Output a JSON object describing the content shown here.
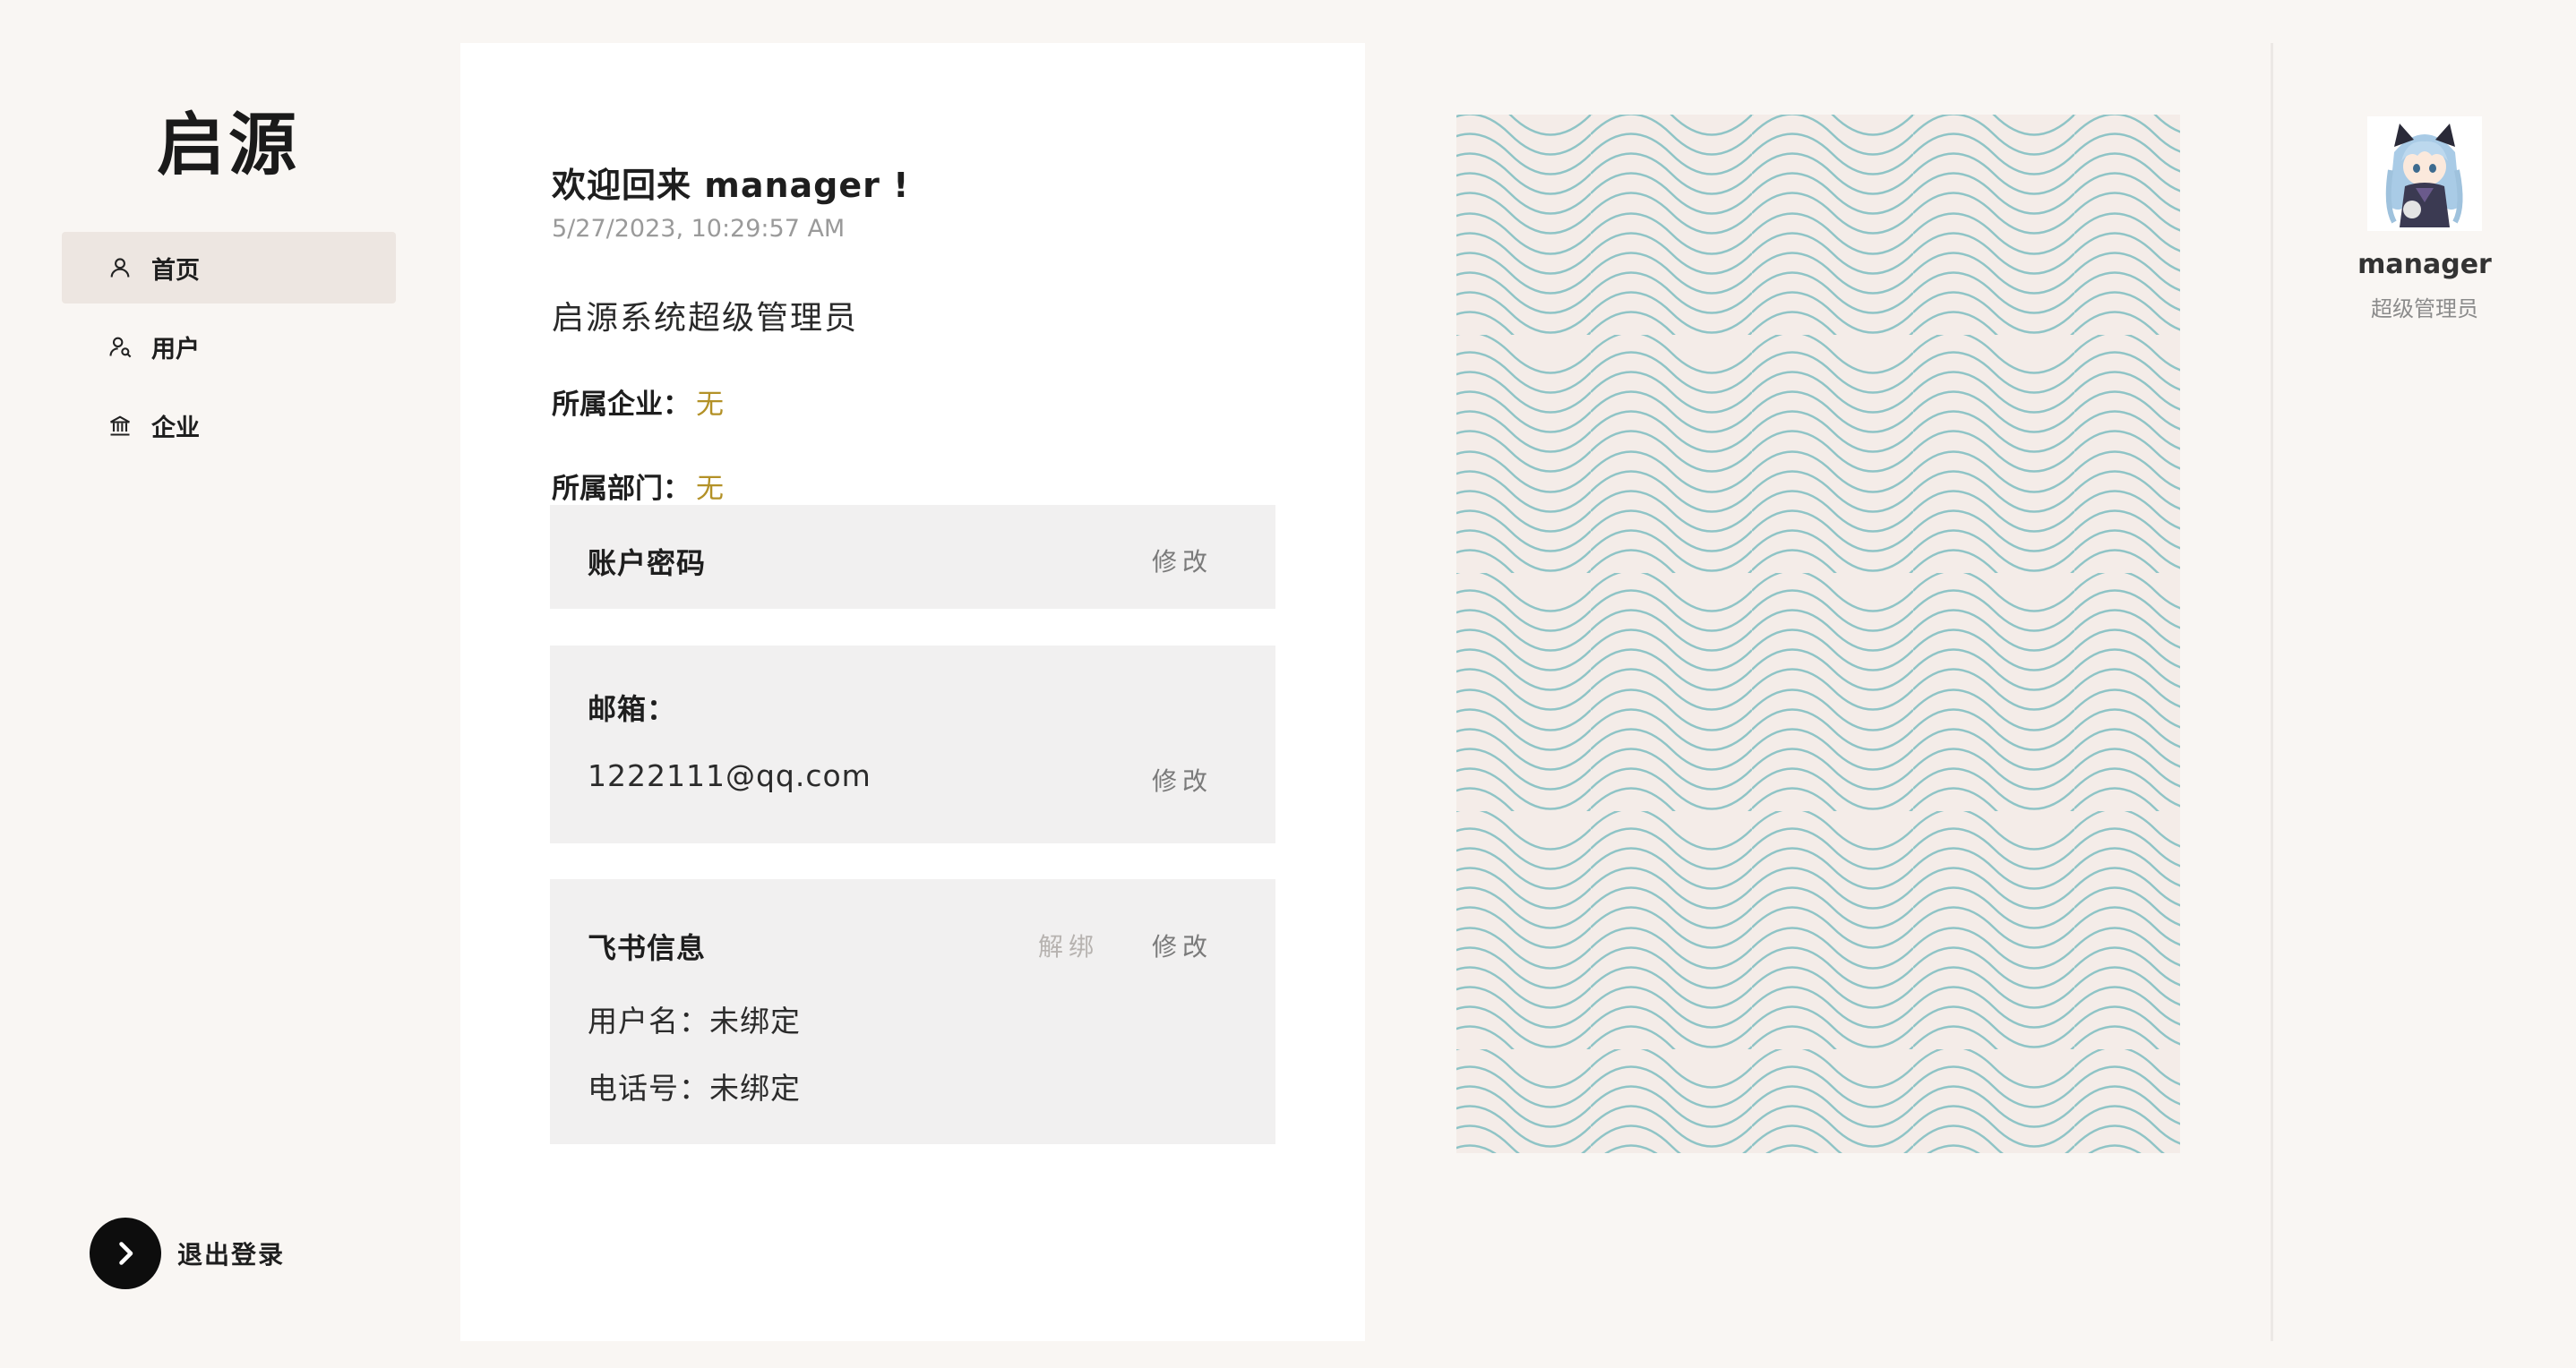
{
  "sidebar": {
    "brand": "启源",
    "items": [
      {
        "label": "首页",
        "icon": "user-icon",
        "active": true
      },
      {
        "label": "用户",
        "icon": "user-search-icon",
        "active": false
      },
      {
        "label": "企业",
        "icon": "bank-icon",
        "active": false
      }
    ],
    "logout_label": "退出登录"
  },
  "main": {
    "welcome": "欢迎回来 manager !",
    "timestamp": "5/27/2023, 10:29:57 AM",
    "role": "启源系统超级管理员",
    "company_label": "所属企业：",
    "company_value": "无",
    "department_label": "所属部门：",
    "department_value": "无",
    "account": {
      "title": "账户密码",
      "edit_label": "修改"
    },
    "email": {
      "title": "邮箱：",
      "value": "1222111@qq.com",
      "edit_label": "修改"
    },
    "feishu": {
      "title": "飞书信息",
      "unbind_label": "解绑",
      "edit_label": "修改",
      "username_label": "用户名：",
      "username_value": "未绑定",
      "phone_label": "电话号：",
      "phone_value": "未绑定"
    }
  },
  "profile": {
    "name": "manager",
    "role": "超级管理员"
  },
  "colors": {
    "background": "#f9f6f3",
    "accent_gold": "#b39127",
    "pattern_line": "#8fc4c6",
    "pattern_bg": "#f4ece8"
  }
}
